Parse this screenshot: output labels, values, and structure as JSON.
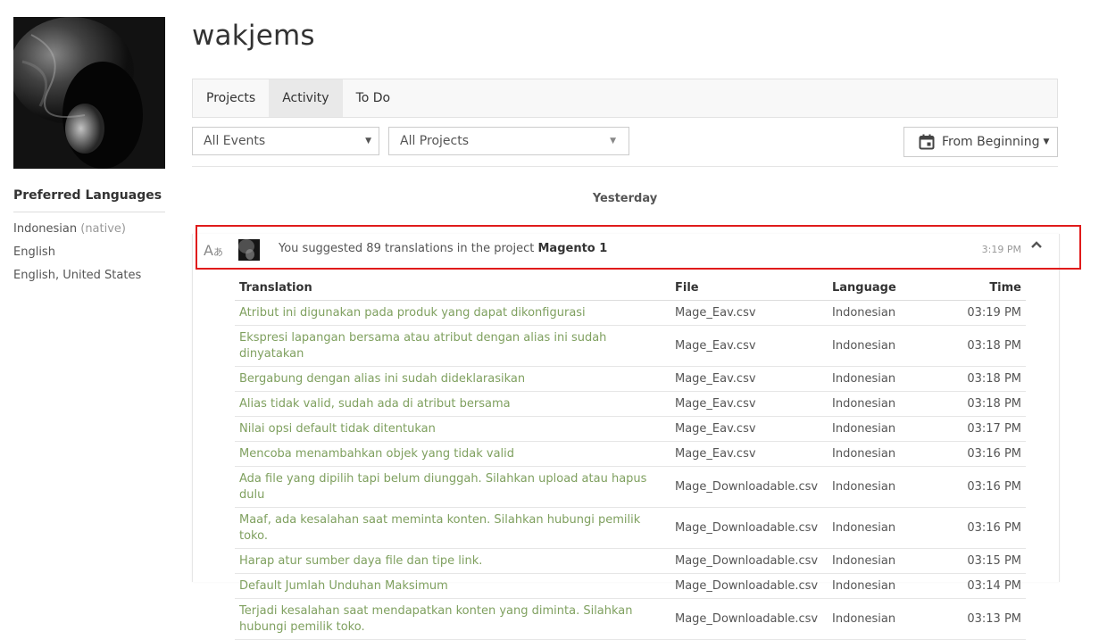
{
  "user": {
    "username": "wakjems"
  },
  "sidebar": {
    "pref_title": "Preferred Languages",
    "languages": [
      {
        "name": "Indonesian",
        "note": "(native)"
      },
      {
        "name": "English",
        "note": ""
      },
      {
        "name": "English, United States",
        "note": ""
      }
    ]
  },
  "tabs": [
    {
      "label": "Projects",
      "active": false
    },
    {
      "label": "Activity",
      "active": true
    },
    {
      "label": "To Do",
      "active": false
    }
  ],
  "filters": {
    "events": "All Events",
    "projects": "All Projects",
    "date": "From Beginning"
  },
  "day_label": "Yesterday",
  "activity": {
    "text_prefix": "You suggested 89 translations in the project",
    "project": "Magento 1",
    "time": "3:19 PM",
    "columns": {
      "translation": "Translation",
      "file": "File",
      "language": "Language",
      "time": "Time"
    },
    "rows": [
      {
        "translation": "Atribut ini digunakan pada produk yang dapat dikonfigurasi",
        "file": "Mage_Eav.csv",
        "language": "Indonesian",
        "time": "03:19 PM"
      },
      {
        "translation": "Ekspresi lapangan bersama atau atribut dengan alias ini sudah dinyatakan",
        "file": "Mage_Eav.csv",
        "language": "Indonesian",
        "time": "03:18 PM"
      },
      {
        "translation": "Bergabung dengan alias ini sudah dideklarasikan",
        "file": "Mage_Eav.csv",
        "language": "Indonesian",
        "time": "03:18 PM"
      },
      {
        "translation": "Alias tidak valid, sudah ada di atribut bersama",
        "file": "Mage_Eav.csv",
        "language": "Indonesian",
        "time": "03:18 PM"
      },
      {
        "translation": "Nilai opsi default tidak ditentukan",
        "file": "Mage_Eav.csv",
        "language": "Indonesian",
        "time": "03:17 PM"
      },
      {
        "translation": "Mencoba menambahkan objek yang tidak valid",
        "file": "Mage_Eav.csv",
        "language": "Indonesian",
        "time": "03:16 PM"
      },
      {
        "translation": "Ada file yang dipilih tapi belum diunggah. Silahkan upload atau hapus dulu",
        "file": "Mage_Downloadable.csv",
        "language": "Indonesian",
        "time": "03:16 PM"
      },
      {
        "translation": "Maaf, ada kesalahan saat meminta konten. Silahkan hubungi pemilik toko.",
        "file": "Mage_Downloadable.csv",
        "language": "Indonesian",
        "time": "03:16 PM"
      },
      {
        "translation": "Harap atur sumber daya file dan tipe link.",
        "file": "Mage_Downloadable.csv",
        "language": "Indonesian",
        "time": "03:15 PM"
      },
      {
        "translation": "Default Jumlah Unduhan Maksimum",
        "file": "Mage_Downloadable.csv",
        "language": "Indonesian",
        "time": "03:14 PM"
      },
      {
        "translation": "Terjadi kesalahan saat mendapatkan konten yang diminta. Silahkan hubungi pemilik toko.",
        "file": "Mage_Downloadable.csv",
        "language": "Indonesian",
        "time": "03:13 PM"
      }
    ]
  },
  "icons": {
    "translate": "translate-icon",
    "calendar": "calendar-icon",
    "collapse": "chevron-up-icon",
    "dropdown": "caret-down-icon"
  }
}
